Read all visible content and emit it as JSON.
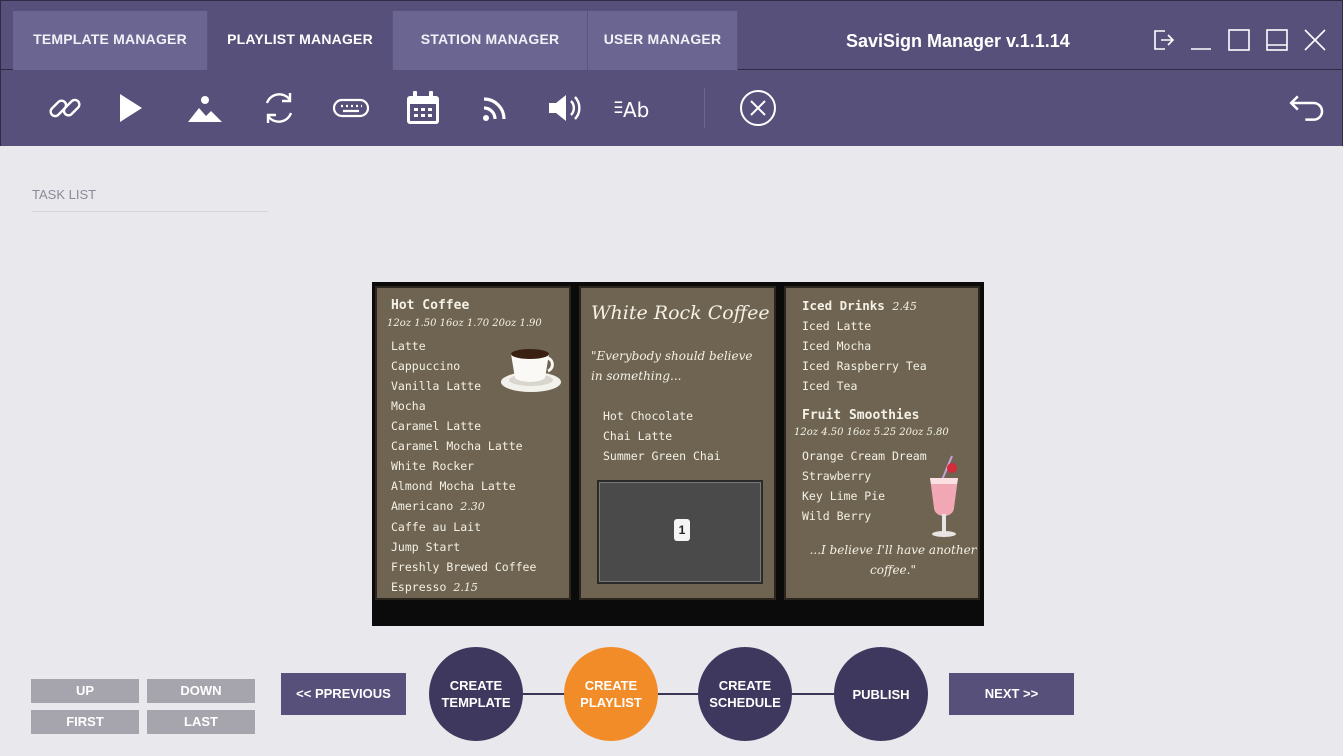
{
  "tabs": [
    {
      "label": "TEMPLATE MANAGER"
    },
    {
      "label": "PLAYLIST MANAGER"
    },
    {
      "label": "STATION MANAGER"
    },
    {
      "label": "USER MANAGER"
    }
  ],
  "app_title": "SaviSign Manager v.1.1.14",
  "window_controls": [
    "logout-icon",
    "minimize-icon",
    "maximize-icon",
    "restore-icon",
    "close-icon"
  ],
  "toolbar_icons": [
    "link-icon",
    "play-icon",
    "image-icon",
    "refresh-icon",
    "keyboard-icon",
    "calendar-icon",
    "rss-icon",
    "volume-icon",
    "text-format-icon",
    "cancel-circle-icon",
    "back-arrow-icon"
  ],
  "task_list": {
    "title": "TASK LIST"
  },
  "preview": {
    "left": {
      "heading": "Hot Coffee",
      "prices": "12oz 1.50 16oz 1.70 20oz 1.90",
      "items": [
        "Latte",
        "Cappuccino",
        "Vanilla Latte",
        "Mocha",
        "Caramel Latte",
        "Caramel Mocha Latte",
        "White Rocker",
        "Almond Mocha Latte"
      ],
      "americano": {
        "name": "Americano",
        "price": "2.30"
      },
      "items2": [
        "Caffe au Lait",
        "Jump Start",
        "Freshly Brewed Coffee"
      ],
      "espresso": {
        "name": "Espresso",
        "price": "2.15"
      }
    },
    "center": {
      "title": "White Rock Coffee",
      "quote": "\"Everybody should believe in something...",
      "items": [
        "Hot Chocolate",
        "Chai Latte",
        "Summer Green Chai"
      ],
      "zone_number": "1"
    },
    "right": {
      "heading": "Iced Drinks",
      "heading_price": "2.45",
      "items": [
        "Iced Latte",
        "Iced Mocha",
        "Iced Raspberry Tea",
        "Iced Tea"
      ],
      "heading2": "Fruit Smoothies",
      "prices2": "12oz 4.50 16oz 5.25 20oz 5.80",
      "items2": [
        "Orange Cream Dream",
        "Strawberry",
        "Key Lime Pie",
        "Wild Berry"
      ],
      "quote": "...I believe I'll have another coffee.\""
    }
  },
  "order_buttons": {
    "up": "UP",
    "down": "DOWN",
    "first": "FIRST",
    "last": "LAST"
  },
  "nav": {
    "previous": "<< PPREVIOUS",
    "next": "NEXT >>"
  },
  "steps": [
    {
      "label": "CREATE TEMPLATE",
      "active": false
    },
    {
      "label": "CREATE PLAYLIST",
      "active": true
    },
    {
      "label": "CREATE SCHEDULE",
      "active": false
    },
    {
      "label": "PUBLISH",
      "active": false
    }
  ],
  "colors": {
    "header": "#56507a",
    "tab_inactive": "#6b6592",
    "step": "#3e385f",
    "step_active": "#f28c28",
    "background": "#e9e8ec"
  }
}
